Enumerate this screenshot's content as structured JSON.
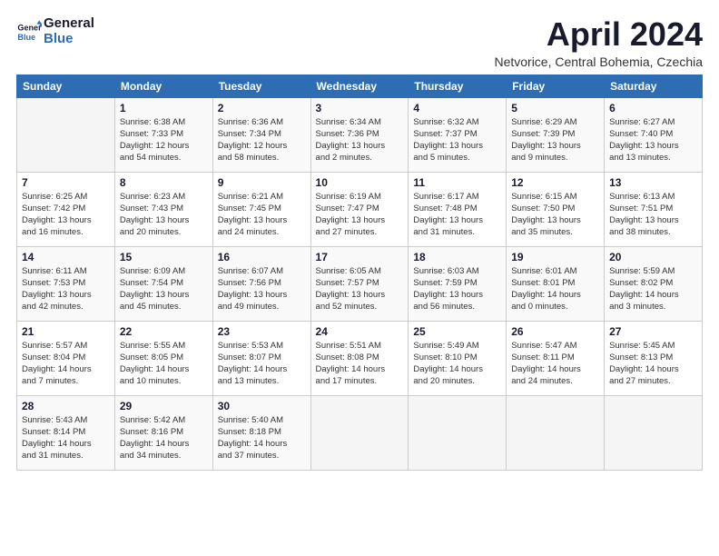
{
  "logo": {
    "line1": "General",
    "line2": "Blue"
  },
  "title": "April 2024",
  "location": "Netvorice, Central Bohemia, Czechia",
  "header_days": [
    "Sunday",
    "Monday",
    "Tuesday",
    "Wednesday",
    "Thursday",
    "Friday",
    "Saturday"
  ],
  "weeks": [
    [
      {
        "day": "",
        "info": ""
      },
      {
        "day": "1",
        "info": "Sunrise: 6:38 AM\nSunset: 7:33 PM\nDaylight: 12 hours\nand 54 minutes."
      },
      {
        "day": "2",
        "info": "Sunrise: 6:36 AM\nSunset: 7:34 PM\nDaylight: 12 hours\nand 58 minutes."
      },
      {
        "day": "3",
        "info": "Sunrise: 6:34 AM\nSunset: 7:36 PM\nDaylight: 13 hours\nand 2 minutes."
      },
      {
        "day": "4",
        "info": "Sunrise: 6:32 AM\nSunset: 7:37 PM\nDaylight: 13 hours\nand 5 minutes."
      },
      {
        "day": "5",
        "info": "Sunrise: 6:29 AM\nSunset: 7:39 PM\nDaylight: 13 hours\nand 9 minutes."
      },
      {
        "day": "6",
        "info": "Sunrise: 6:27 AM\nSunset: 7:40 PM\nDaylight: 13 hours\nand 13 minutes."
      }
    ],
    [
      {
        "day": "7",
        "info": "Sunrise: 6:25 AM\nSunset: 7:42 PM\nDaylight: 13 hours\nand 16 minutes."
      },
      {
        "day": "8",
        "info": "Sunrise: 6:23 AM\nSunset: 7:43 PM\nDaylight: 13 hours\nand 20 minutes."
      },
      {
        "day": "9",
        "info": "Sunrise: 6:21 AM\nSunset: 7:45 PM\nDaylight: 13 hours\nand 24 minutes."
      },
      {
        "day": "10",
        "info": "Sunrise: 6:19 AM\nSunset: 7:47 PM\nDaylight: 13 hours\nand 27 minutes."
      },
      {
        "day": "11",
        "info": "Sunrise: 6:17 AM\nSunset: 7:48 PM\nDaylight: 13 hours\nand 31 minutes."
      },
      {
        "day": "12",
        "info": "Sunrise: 6:15 AM\nSunset: 7:50 PM\nDaylight: 13 hours\nand 35 minutes."
      },
      {
        "day": "13",
        "info": "Sunrise: 6:13 AM\nSunset: 7:51 PM\nDaylight: 13 hours\nand 38 minutes."
      }
    ],
    [
      {
        "day": "14",
        "info": "Sunrise: 6:11 AM\nSunset: 7:53 PM\nDaylight: 13 hours\nand 42 minutes."
      },
      {
        "day": "15",
        "info": "Sunrise: 6:09 AM\nSunset: 7:54 PM\nDaylight: 13 hours\nand 45 minutes."
      },
      {
        "day": "16",
        "info": "Sunrise: 6:07 AM\nSunset: 7:56 PM\nDaylight: 13 hours\nand 49 minutes."
      },
      {
        "day": "17",
        "info": "Sunrise: 6:05 AM\nSunset: 7:57 PM\nDaylight: 13 hours\nand 52 minutes."
      },
      {
        "day": "18",
        "info": "Sunrise: 6:03 AM\nSunset: 7:59 PM\nDaylight: 13 hours\nand 56 minutes."
      },
      {
        "day": "19",
        "info": "Sunrise: 6:01 AM\nSunset: 8:01 PM\nDaylight: 14 hours\nand 0 minutes."
      },
      {
        "day": "20",
        "info": "Sunrise: 5:59 AM\nSunset: 8:02 PM\nDaylight: 14 hours\nand 3 minutes."
      }
    ],
    [
      {
        "day": "21",
        "info": "Sunrise: 5:57 AM\nSunset: 8:04 PM\nDaylight: 14 hours\nand 7 minutes."
      },
      {
        "day": "22",
        "info": "Sunrise: 5:55 AM\nSunset: 8:05 PM\nDaylight: 14 hours\nand 10 minutes."
      },
      {
        "day": "23",
        "info": "Sunrise: 5:53 AM\nSunset: 8:07 PM\nDaylight: 14 hours\nand 13 minutes."
      },
      {
        "day": "24",
        "info": "Sunrise: 5:51 AM\nSunset: 8:08 PM\nDaylight: 14 hours\nand 17 minutes."
      },
      {
        "day": "25",
        "info": "Sunrise: 5:49 AM\nSunset: 8:10 PM\nDaylight: 14 hours\nand 20 minutes."
      },
      {
        "day": "26",
        "info": "Sunrise: 5:47 AM\nSunset: 8:11 PM\nDaylight: 14 hours\nand 24 minutes."
      },
      {
        "day": "27",
        "info": "Sunrise: 5:45 AM\nSunset: 8:13 PM\nDaylight: 14 hours\nand 27 minutes."
      }
    ],
    [
      {
        "day": "28",
        "info": "Sunrise: 5:43 AM\nSunset: 8:14 PM\nDaylight: 14 hours\nand 31 minutes."
      },
      {
        "day": "29",
        "info": "Sunrise: 5:42 AM\nSunset: 8:16 PM\nDaylight: 14 hours\nand 34 minutes."
      },
      {
        "day": "30",
        "info": "Sunrise: 5:40 AM\nSunset: 8:18 PM\nDaylight: 14 hours\nand 37 minutes."
      },
      {
        "day": "",
        "info": ""
      },
      {
        "day": "",
        "info": ""
      },
      {
        "day": "",
        "info": ""
      },
      {
        "day": "",
        "info": ""
      }
    ]
  ]
}
